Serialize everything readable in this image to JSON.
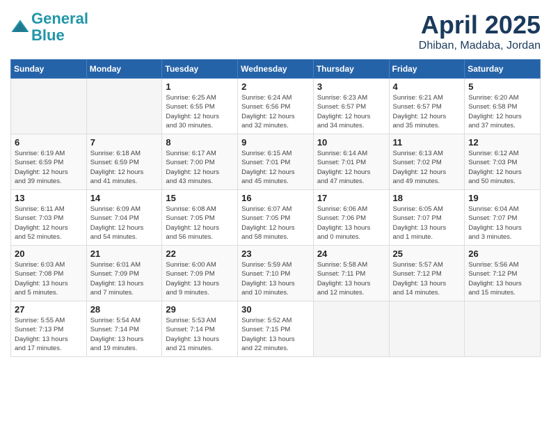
{
  "header": {
    "logo_line1": "General",
    "logo_line2": "Blue",
    "month_title": "April 2025",
    "location": "Dhiban, Madaba, Jordan"
  },
  "weekdays": [
    "Sunday",
    "Monday",
    "Tuesday",
    "Wednesday",
    "Thursday",
    "Friday",
    "Saturday"
  ],
  "weeks": [
    [
      {
        "day": "",
        "info": ""
      },
      {
        "day": "",
        "info": ""
      },
      {
        "day": "1",
        "info": "Sunrise: 6:25 AM\nSunset: 6:55 PM\nDaylight: 12 hours\nand 30 minutes."
      },
      {
        "day": "2",
        "info": "Sunrise: 6:24 AM\nSunset: 6:56 PM\nDaylight: 12 hours\nand 32 minutes."
      },
      {
        "day": "3",
        "info": "Sunrise: 6:23 AM\nSunset: 6:57 PM\nDaylight: 12 hours\nand 34 minutes."
      },
      {
        "day": "4",
        "info": "Sunrise: 6:21 AM\nSunset: 6:57 PM\nDaylight: 12 hours\nand 35 minutes."
      },
      {
        "day": "5",
        "info": "Sunrise: 6:20 AM\nSunset: 6:58 PM\nDaylight: 12 hours\nand 37 minutes."
      }
    ],
    [
      {
        "day": "6",
        "info": "Sunrise: 6:19 AM\nSunset: 6:59 PM\nDaylight: 12 hours\nand 39 minutes."
      },
      {
        "day": "7",
        "info": "Sunrise: 6:18 AM\nSunset: 6:59 PM\nDaylight: 12 hours\nand 41 minutes."
      },
      {
        "day": "8",
        "info": "Sunrise: 6:17 AM\nSunset: 7:00 PM\nDaylight: 12 hours\nand 43 minutes."
      },
      {
        "day": "9",
        "info": "Sunrise: 6:15 AM\nSunset: 7:01 PM\nDaylight: 12 hours\nand 45 minutes."
      },
      {
        "day": "10",
        "info": "Sunrise: 6:14 AM\nSunset: 7:01 PM\nDaylight: 12 hours\nand 47 minutes."
      },
      {
        "day": "11",
        "info": "Sunrise: 6:13 AM\nSunset: 7:02 PM\nDaylight: 12 hours\nand 49 minutes."
      },
      {
        "day": "12",
        "info": "Sunrise: 6:12 AM\nSunset: 7:03 PM\nDaylight: 12 hours\nand 50 minutes."
      }
    ],
    [
      {
        "day": "13",
        "info": "Sunrise: 6:11 AM\nSunset: 7:03 PM\nDaylight: 12 hours\nand 52 minutes."
      },
      {
        "day": "14",
        "info": "Sunrise: 6:09 AM\nSunset: 7:04 PM\nDaylight: 12 hours\nand 54 minutes."
      },
      {
        "day": "15",
        "info": "Sunrise: 6:08 AM\nSunset: 7:05 PM\nDaylight: 12 hours\nand 56 minutes."
      },
      {
        "day": "16",
        "info": "Sunrise: 6:07 AM\nSunset: 7:05 PM\nDaylight: 12 hours\nand 58 minutes."
      },
      {
        "day": "17",
        "info": "Sunrise: 6:06 AM\nSunset: 7:06 PM\nDaylight: 13 hours\nand 0 minutes."
      },
      {
        "day": "18",
        "info": "Sunrise: 6:05 AM\nSunset: 7:07 PM\nDaylight: 13 hours\nand 1 minute."
      },
      {
        "day": "19",
        "info": "Sunrise: 6:04 AM\nSunset: 7:07 PM\nDaylight: 13 hours\nand 3 minutes."
      }
    ],
    [
      {
        "day": "20",
        "info": "Sunrise: 6:03 AM\nSunset: 7:08 PM\nDaylight: 13 hours\nand 5 minutes."
      },
      {
        "day": "21",
        "info": "Sunrise: 6:01 AM\nSunset: 7:09 PM\nDaylight: 13 hours\nand 7 minutes."
      },
      {
        "day": "22",
        "info": "Sunrise: 6:00 AM\nSunset: 7:09 PM\nDaylight: 13 hours\nand 9 minutes."
      },
      {
        "day": "23",
        "info": "Sunrise: 5:59 AM\nSunset: 7:10 PM\nDaylight: 13 hours\nand 10 minutes."
      },
      {
        "day": "24",
        "info": "Sunrise: 5:58 AM\nSunset: 7:11 PM\nDaylight: 13 hours\nand 12 minutes."
      },
      {
        "day": "25",
        "info": "Sunrise: 5:57 AM\nSunset: 7:12 PM\nDaylight: 13 hours\nand 14 minutes."
      },
      {
        "day": "26",
        "info": "Sunrise: 5:56 AM\nSunset: 7:12 PM\nDaylight: 13 hours\nand 15 minutes."
      }
    ],
    [
      {
        "day": "27",
        "info": "Sunrise: 5:55 AM\nSunset: 7:13 PM\nDaylight: 13 hours\nand 17 minutes."
      },
      {
        "day": "28",
        "info": "Sunrise: 5:54 AM\nSunset: 7:14 PM\nDaylight: 13 hours\nand 19 minutes."
      },
      {
        "day": "29",
        "info": "Sunrise: 5:53 AM\nSunset: 7:14 PM\nDaylight: 13 hours\nand 21 minutes."
      },
      {
        "day": "30",
        "info": "Sunrise: 5:52 AM\nSunset: 7:15 PM\nDaylight: 13 hours\nand 22 minutes."
      },
      {
        "day": "",
        "info": ""
      },
      {
        "day": "",
        "info": ""
      },
      {
        "day": "",
        "info": ""
      }
    ]
  ]
}
